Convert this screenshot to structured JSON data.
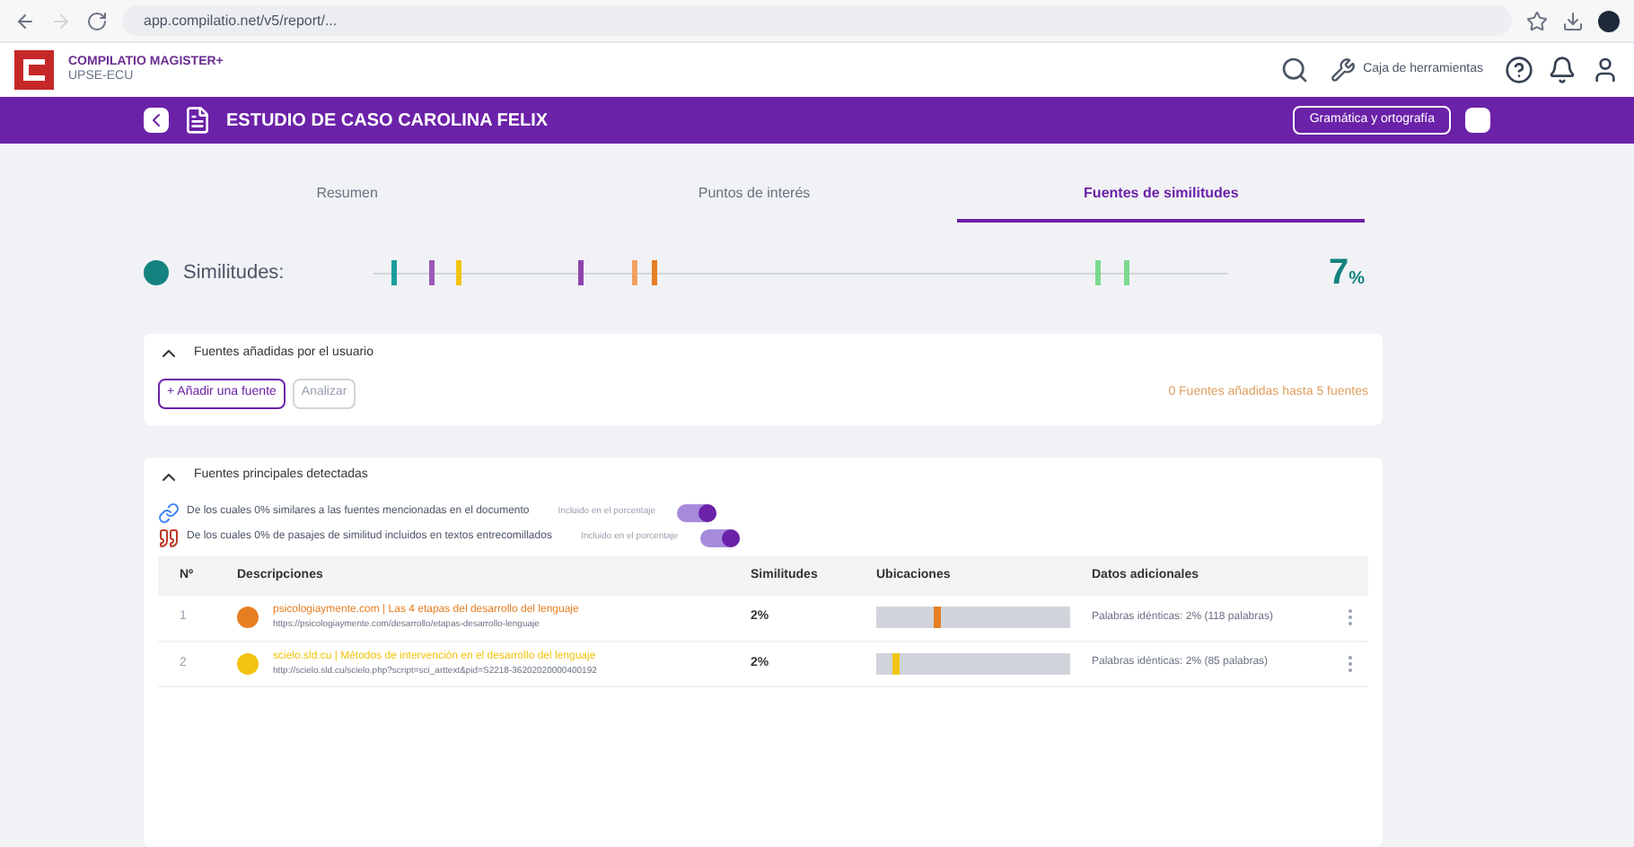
{
  "browser": {
    "url": "app.compilatio.net/v5/report/..."
  },
  "header": {
    "product": "COMPILATIO MAGISTER+",
    "org": "UPSE-ECU",
    "toolbox": "Caja de herramientas"
  },
  "document": {
    "title": "ESTUDIO DE CASO CAROLINA FELIX",
    "grammar_button": "Gramática y ortografía"
  },
  "tabs": [
    {
      "label": "Resumen",
      "selected": false
    },
    {
      "label": "Puntos de interés",
      "selected": false
    },
    {
      "label": "Fuentes de similitudes",
      "selected": true
    }
  ],
  "similarity": {
    "label": "Similitudes:",
    "percent": "7",
    "unit": "%",
    "marks": [
      {
        "color": "#1a9c9c"
      },
      {
        "color": "#9b59b6"
      },
      {
        "color": "#f1c40f"
      },
      {
        "color": "#8e44ad"
      },
      {
        "color": "#f0a060"
      },
      {
        "color": "#e67e22"
      },
      {
        "color": "#7bd88f"
      },
      {
        "color": "#7bd88f"
      }
    ]
  },
  "user_sources": {
    "title": "Fuentes añadidas por el usuario",
    "expanded": true,
    "add_button": "+ Añadir una fuente",
    "analyze_button": "Analizar",
    "limit": "0 Fuentes añadidas hasta 5 fuentes"
  },
  "main_sources": {
    "title": "Fuentes principales detectadas",
    "expanded": true,
    "toggles": [
      {
        "text": "De los cuales 0% similares a las fuentes mencionadas en el documento",
        "label": "Incluido en el porcentaje",
        "on": true
      },
      {
        "text": "De los cuales 0% de pasajes de similitud incluidos en textos entrecomillados",
        "label": "Incluido en el porcentaje",
        "on": true
      }
    ],
    "columns": [
      "Nº",
      "Descripciones",
      "Similitudes",
      "Ubicaciones",
      "Datos adicionales"
    ],
    "rows": [
      {
        "number": "1",
        "color": "#e67e22",
        "site": "psicologiaymente.com",
        "title": "| Las 4 etapas del desarrollo del lenguaje",
        "url": "https://psicologiaymente.com/desarrollo/etapas-desarrollo-lenguaje",
        "percent": "2%",
        "level": 0.3,
        "details": "Palabras idénticas: 2% (118 palabras)"
      },
      {
        "number": "2",
        "color": "#f1c40f",
        "site": "scielo.sld.cu",
        "title": "| Métodos de intervención en el desarrollo del lenguaje",
        "url": "http://scielo.sld.cu/scielo.php?script=sci_arttext&pid=S2218-36202020000400192",
        "percent": "2%",
        "level": 0.08,
        "details": "Palabras idénticas: 2% (85 palabras)"
      }
    ]
  }
}
